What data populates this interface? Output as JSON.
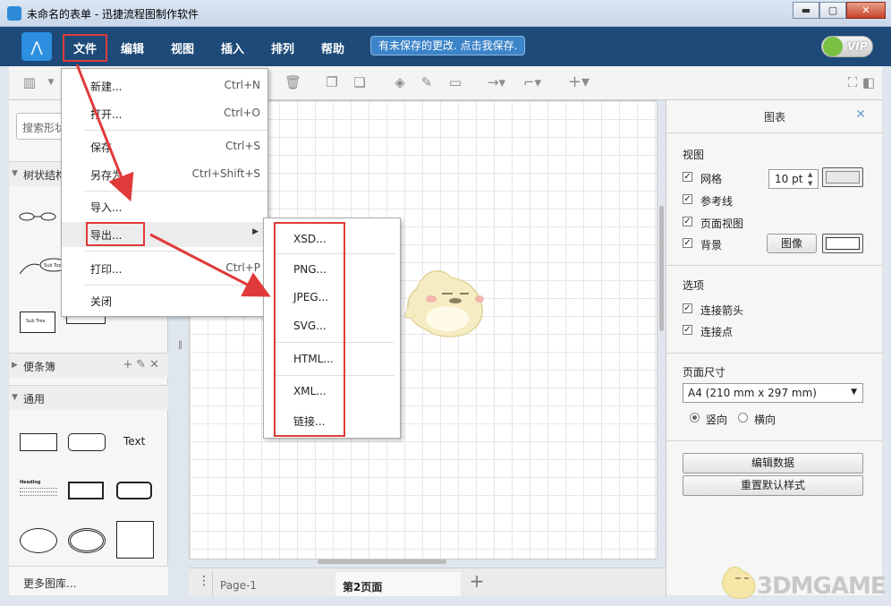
{
  "window": {
    "title": "未命名的表单 - 迅捷流程图制作软件",
    "min": "▬",
    "max": "▢",
    "close": "✕"
  },
  "menubar": {
    "items": [
      "文件",
      "编辑",
      "视图",
      "插入",
      "排列",
      "帮助"
    ],
    "save_notice": "有未保存的更改. 点击我保存.",
    "vip": "VIP"
  },
  "left": {
    "search_placeholder": "搜索形状",
    "sections": [
      "树状结构",
      "便条簿",
      "通用"
    ],
    "shape_text": "Text",
    "shape_heading": "Heading",
    "sub_topic": "Sub Topic",
    "sub_tree": "Sub Tree",
    "more": "更多图库..."
  },
  "file_menu": {
    "items": [
      {
        "label": "新建...",
        "shortcut": "Ctrl+N"
      },
      {
        "label": "打开...",
        "shortcut": "Ctrl+O"
      },
      {
        "label": "保存",
        "shortcut": "Ctrl+S"
      },
      {
        "label": "另存为...",
        "shortcut": "Ctrl+Shift+S"
      },
      {
        "label": "导入...",
        "shortcut": ""
      },
      {
        "label": "导出...",
        "shortcut": ""
      },
      {
        "label": "打印...",
        "shortcut": "Ctrl+P"
      },
      {
        "label": "关闭",
        "shortcut": ""
      }
    ]
  },
  "export_menu": {
    "items": [
      "XSD...",
      "PNG...",
      "JPEG...",
      "SVG...",
      "HTML...",
      "XML...",
      "链接..."
    ]
  },
  "pages": {
    "tab1": "Page-1",
    "tab2": "第2页面"
  },
  "right": {
    "title": "图表",
    "view_label": "视图",
    "grid": "网格",
    "grid_size": "10 pt",
    "guides": "参考线",
    "page_view": "页面视图",
    "background": "背景",
    "image_button": "图像",
    "options_label": "选项",
    "connect_arrows": "连接箭头",
    "connect_points": "连接点",
    "page_size_label": "页面尺寸",
    "page_size_value": "A4 (210 mm x 297 mm)",
    "portrait": "竖向",
    "landscape": "横向",
    "edit_data": "编辑数据",
    "reset_style": "重置默认样式"
  },
  "watermark": "3DMGAME",
  "colors": {
    "menubar": "#1d4a78",
    "annotation_red": "#e03a3a",
    "save_notice_bg": "#3c84c8"
  }
}
